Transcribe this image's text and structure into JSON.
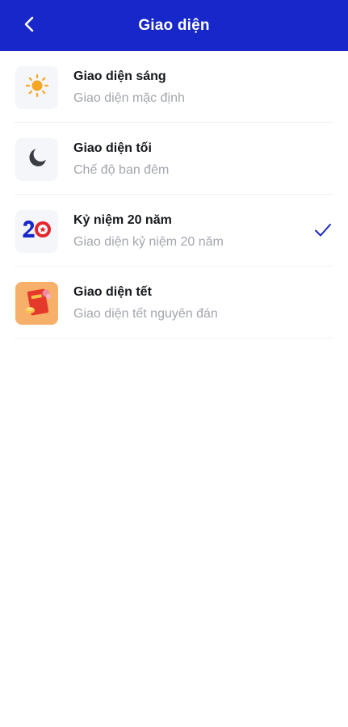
{
  "header": {
    "title": "Giao diện",
    "back_icon": "chevron-left-icon",
    "background": "#1727c9"
  },
  "themes": [
    {
      "title": "Giao diện sáng",
      "subtitle": "Giao diện mặc định",
      "icon": "sun-icon",
      "selected": false
    },
    {
      "title": "Giao diện tối",
      "subtitle": "Chế độ ban đêm",
      "icon": "moon-icon",
      "selected": false
    },
    {
      "title": "Kỷ niệm 20 năm",
      "subtitle": "Giao diện kỷ niệm 20 năm",
      "icon": "anniversary-20-icon",
      "selected": true
    },
    {
      "title": "Giao diện tết",
      "subtitle": "Giao diện tết nguyên đán",
      "icon": "lunar-new-year-icon",
      "selected": false
    }
  ],
  "colors": {
    "accent": "#1727c9",
    "sun": "#f5a623",
    "moon": "#3a3d44",
    "title_text": "#16181d",
    "subtitle_text": "#a3a6ad"
  }
}
